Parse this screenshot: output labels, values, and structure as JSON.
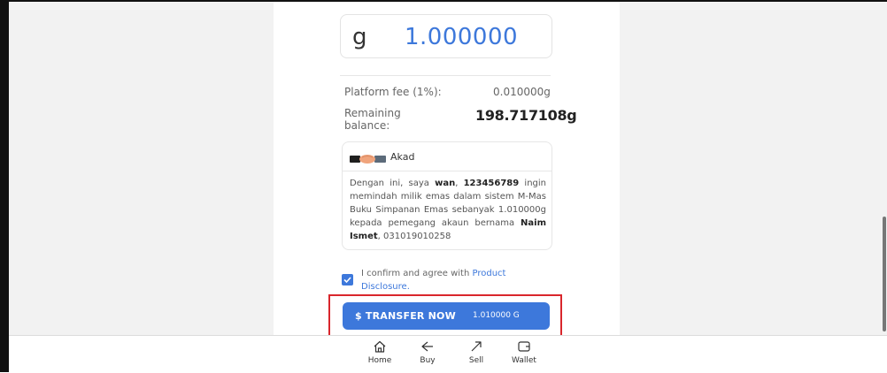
{
  "amount": {
    "unit": "g",
    "value": "1.000000"
  },
  "summary": {
    "fee_label": "Platform fee (1%):",
    "fee_value": "0.010000g",
    "remaining_label": "Remaining balance:",
    "remaining_value": "198.717108g"
  },
  "akad": {
    "title": "Akad",
    "icon": "handshake-icon",
    "p1": "Dengan ini, saya ",
    "name": "wan",
    "p2": ", ",
    "ic": "123456789",
    "p3": " ingin memindah milik emas dalam sistem M-Mas Buku Simpanan Emas sebanyak 1.010000g kepada pemegang akaun bernama ",
    "recipient": "Naim Ismet",
    "p4": ", 031019010258"
  },
  "confirm": {
    "checked": true,
    "text": "I confirm and agree with ",
    "link": "Product Disclosure",
    "suffix": "."
  },
  "transfer_button": {
    "label": "$ TRANSFER NOW",
    "amount": "1.010000 G",
    "color": "#3d78db"
  },
  "nav": [
    {
      "label": "Home",
      "icon": "home-icon"
    },
    {
      "label": "Buy",
      "icon": "buy-icon"
    },
    {
      "label": "Sell",
      "icon": "sell-icon"
    },
    {
      "label": "Wallet",
      "icon": "wallet-icon"
    }
  ],
  "highlight_color": "#d9262c"
}
